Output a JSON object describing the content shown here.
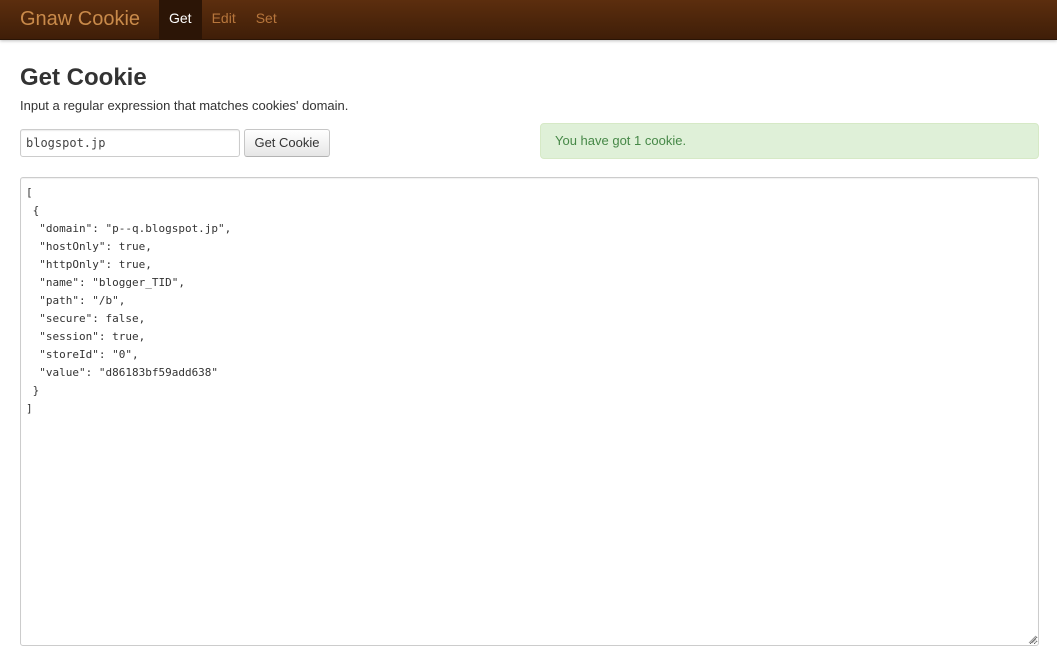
{
  "navbar": {
    "brand": "Gnaw Cookie",
    "items": [
      {
        "label": "Get",
        "active": true
      },
      {
        "label": "Edit",
        "active": false
      },
      {
        "label": "Set",
        "active": false
      }
    ]
  },
  "main": {
    "title": "Get Cookie",
    "subtitle": "Input a regular expression that matches cookies' domain.",
    "regex_input_value": "blogspot.jp",
    "get_button_label": "Get Cookie",
    "alert_text": "You have got 1 cookie.",
    "output_text": "[\n {\n  \"domain\": \"p--q.blogspot.jp\",\n  \"hostOnly\": true,\n  \"httpOnly\": true,\n  \"name\": \"blogger_TID\",\n  \"path\": \"/b\",\n  \"secure\": false,\n  \"session\": true,\n  \"storeId\": \"0\",\n  \"value\": \"d86183bf59add638\"\n }\n]"
  },
  "colors": {
    "navbar_bg": "#4a240b",
    "brand": "#c98a4a",
    "alert_bg": "#dff0d8",
    "alert_text": "#468847"
  }
}
